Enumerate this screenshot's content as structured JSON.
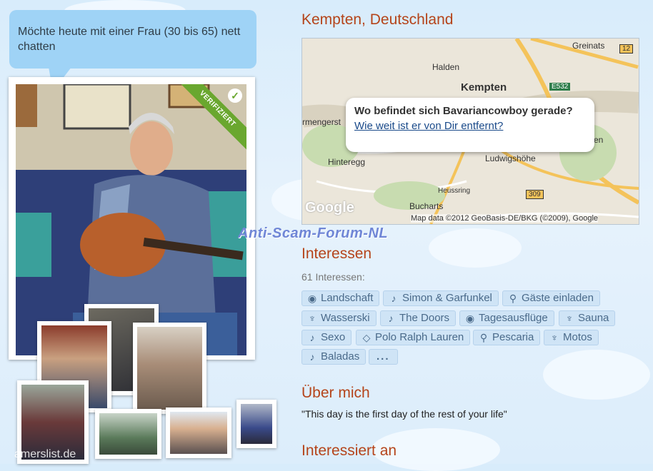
{
  "bubble": {
    "text": "Möchte heute mit einer Frau (30 bis 65) nett chatten"
  },
  "photo": {
    "verified_label": "VERIFIZIERT"
  },
  "location": {
    "title": "Kempten, Deutschland",
    "map": {
      "labels": [
        "Greinats",
        "Halden",
        "Kempten",
        "rmengerst",
        "Hinteregg",
        "Ludwigshöhe",
        "Heussring",
        "Bucharts",
        "en"
      ],
      "road_badges": [
        "12",
        "E532",
        "309"
      ],
      "popup_question": "Wo befindet sich Bavariancowboy gerade?",
      "popup_link": "Wie weit ist er von Dir entfernt?",
      "attribution": "Map data ©2012 GeoBasis-DE/BKG (©2009), Google",
      "logo": "Google"
    }
  },
  "watermark": "Anti-Scam-Forum-NL",
  "interests": {
    "title": "Interessen",
    "count_label": "61 Interessen:",
    "tags": [
      {
        "label": "Landschaft",
        "icon": "globe-icon"
      },
      {
        "label": "Simon & Garfunkel",
        "icon": "music-note-icon"
      },
      {
        "label": "Gäste einladen",
        "icon": "guitar-icon"
      },
      {
        "label": "Wasserski",
        "icon": "trophy-icon"
      },
      {
        "label": "The Doors",
        "icon": "music-note-icon"
      },
      {
        "label": "Tagesausflüge",
        "icon": "globe-icon"
      },
      {
        "label": "Sauna",
        "icon": "trophy-icon"
      },
      {
        "label": "Sexo",
        "icon": "music-note-icon"
      },
      {
        "label": "Polo Ralph Lauren",
        "icon": "diamond-icon"
      },
      {
        "label": "Pescaria",
        "icon": "guitar-icon"
      },
      {
        "label": "Motos",
        "icon": "trophy-icon"
      },
      {
        "label": "Baladas",
        "icon": "music-note-icon"
      }
    ],
    "more_label": "..."
  },
  "about": {
    "title": "Über mich",
    "text": "\"This day is the first day of the rest of your life\""
  },
  "interested_in": {
    "title": "Interessiert an"
  },
  "site_watermark": "amerslist.de",
  "colors": {
    "accent": "#b5441a",
    "tag_bg": "#cfe4f6",
    "bubble_bg": "#9fd3f6",
    "verified": "#6aa72f"
  }
}
